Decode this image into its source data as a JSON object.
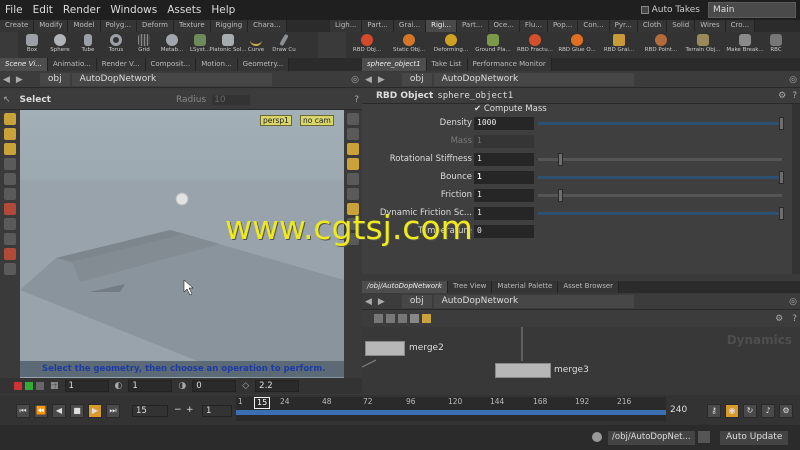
{
  "menu": [
    "File",
    "Edit",
    "Render",
    "Windows",
    "Assets",
    "Help"
  ],
  "auto_takes": "Auto Takes",
  "desktop": "Main",
  "shelf_tabs": [
    "Create",
    "Modify",
    "Model",
    "Polyg...",
    "Deform",
    "Texture",
    "Rigging",
    "Chara...",
    "Ligh...",
    "Part...",
    "Grai...",
    "Rigi...",
    "Part...",
    "Oce...",
    "Flu...",
    "Pop...",
    "Con...",
    "Pyr...",
    "Cloth",
    "Solid",
    "Wires",
    "Cro..."
  ],
  "shelf_tools_left": [
    "Box",
    "Sphere",
    "Tube",
    "Torus",
    "Grid",
    "Metab...",
    "LSyst...",
    "Platonic Sol...",
    "Curve",
    "Draw Cu"
  ],
  "shelf_tools_right": [
    "RBD Obj...",
    "Static Obj...",
    "Deforming...",
    "Ground Pla...",
    "RBD Fractu...",
    "RBD Glue O...",
    "RBD Grai...",
    "RBD Point...",
    "Terrain Obj...",
    "Make Break...",
    "RBC"
  ],
  "left_tabs": [
    "Scene Vi...",
    "Animatio...",
    "Render V...",
    "Composit...",
    "Motion...",
    "Geometry..."
  ],
  "left_path": {
    "network": "obj",
    "node": "AutoDopNetwork"
  },
  "viewport": {
    "tool": "Select",
    "radius_label": "Radius",
    "radius_value": "10",
    "camera": "persp1",
    "no_cam": "no cam",
    "hint": "Select the geometry, then choose an operation to perform.",
    "status_fields": [
      "1",
      "1",
      "0",
      "2.2"
    ]
  },
  "parm_tabs": [
    "sphere_object1",
    "Take List",
    "Performance Monitor"
  ],
  "parm_path": {
    "network": "obj",
    "node": "AutoDopNetwork"
  },
  "parm_header": {
    "type": "RBD Object",
    "name": "sphere_object1"
  },
  "compute_mass": "Compute Mass",
  "params": [
    {
      "label": "Density",
      "value": "1000"
    },
    {
      "label": "Mass",
      "value": "1"
    },
    {
      "label": "Rotational Stiffness",
      "value": "1"
    },
    {
      "label": "Bounce",
      "value": "1"
    },
    {
      "label": "Friction",
      "value": "1"
    },
    {
      "label": "Dynamic Friction Sc...",
      "value": "1"
    },
    {
      "label": "Temperature",
      "value": "0"
    }
  ],
  "net_tabs": [
    "/obj/AutoDopNetwork",
    "Tree View",
    "Material Palette",
    "Asset Browser"
  ],
  "net_path": {
    "network": "obj",
    "node": "AutoDopNetwork"
  },
  "network_context": "Dynamics",
  "nodes": [
    "merge2",
    "merge3"
  ],
  "timeline": {
    "current_frame": "15",
    "start_field": "15",
    "step_field": "1",
    "end_frame": "240",
    "ruler_start": "1",
    "ruler_ticks": [
      "15",
      "24",
      "48",
      "72",
      "96",
      "120",
      "144",
      "168",
      "192",
      "216"
    ]
  },
  "status_path": "/obj/AutoDopNet...",
  "auto_update": "Auto Update",
  "watermark": "www.cgtsj.com"
}
